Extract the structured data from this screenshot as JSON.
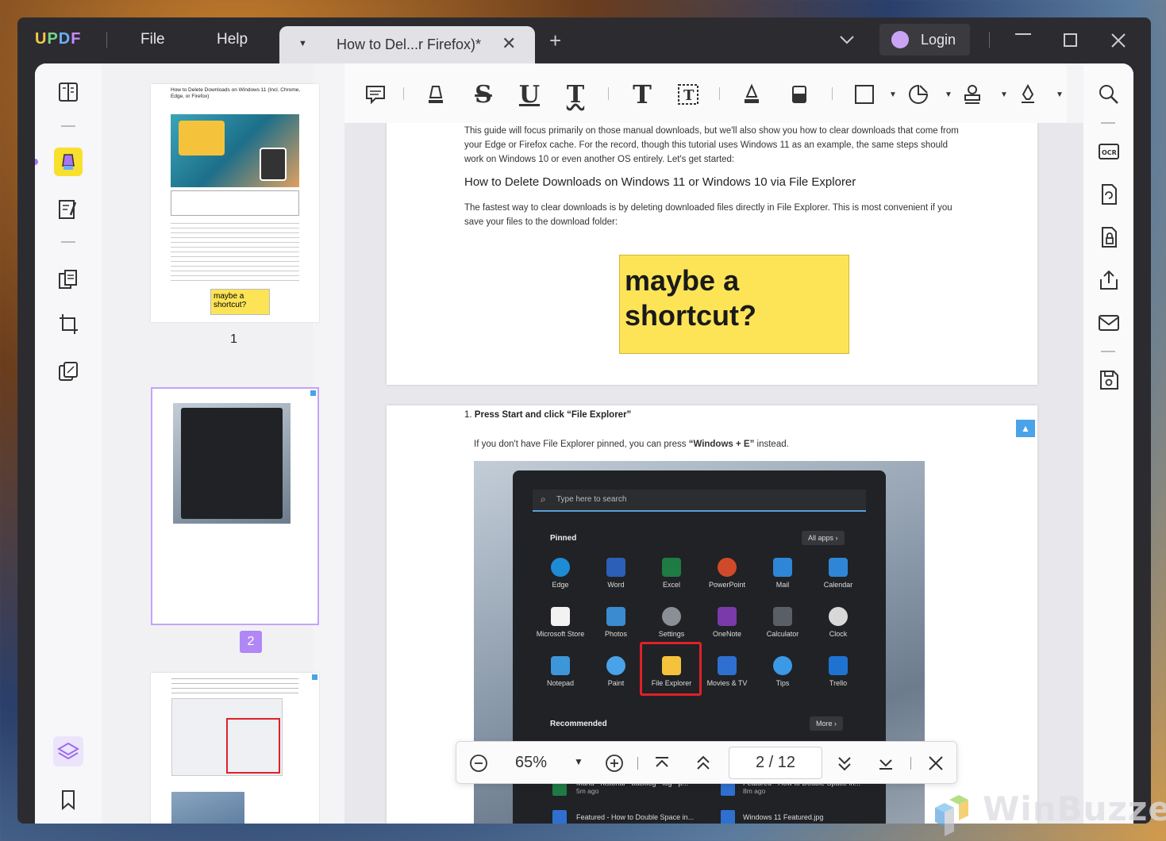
{
  "titlebar": {
    "logo": [
      "U",
      "P",
      "D",
      "F"
    ],
    "menu": {
      "file": "File",
      "help": "Help"
    },
    "tab_title": "How to Del...r Firefox)*",
    "tab_close": "✕",
    "new_tab": "+",
    "login": "Login"
  },
  "thumbnails": {
    "page1_number": "1",
    "page2_number": "2",
    "page1_title": "How to Delete Downloads on Windows 11 (Incl. Chrome, Edge, or Firefox)",
    "page1_sticky": "maybe a shortcut?"
  },
  "document": {
    "intro": "This guide will focus primarily on those manual downloads, but we'll also show you how to clear downloads that come from your Edge or Firefox cache. For the record, though this tutorial uses Windows 11 as an example, the same steps should work on Windows 10 or even another OS entirely. Let's get started:",
    "heading": "How to Delete Downloads on Windows 11 or Windows 10 via File Explorer",
    "paragraph": "The fastest way to clear downloads is by deleting downloaded files directly in File Explorer. This is most convenient if you save your files to the download folder:",
    "sticky_line1": "maybe a",
    "sticky_line2": "shortcut?",
    "step_number": "1.",
    "step_title": "Press Start and click “File Explorer”",
    "step_note_pre": "If you don't have File Explorer pinned, you can press ",
    "step_note_bold": "“Windows + E”",
    "step_note_post": " instead."
  },
  "startmenu": {
    "search_placeholder": "Type here to search",
    "pinned_label": "Pinned",
    "all_apps": "All apps  ›",
    "apps": [
      {
        "name": "Edge",
        "color": "#1e8bd6"
      },
      {
        "name": "Word",
        "color": "#2b5fb8"
      },
      {
        "name": "Excel",
        "color": "#1e7b44"
      },
      {
        "name": "PowerPoint",
        "color": "#d04a2a"
      },
      {
        "name": "Mail",
        "color": "#2f86d6"
      },
      {
        "name": "Calendar",
        "color": "#2f86d6"
      },
      {
        "name": "Microsoft Store",
        "color": "#f2f2f2"
      },
      {
        "name": "Photos",
        "color": "#3a8bd0"
      },
      {
        "name": "Settings",
        "color": "#8a8f96"
      },
      {
        "name": "OneNote",
        "color": "#7a3aa8"
      },
      {
        "name": "Calculator",
        "color": "#5a5f66"
      },
      {
        "name": "Clock",
        "color": "#d8d8d8"
      },
      {
        "name": "Notepad",
        "color": "#3d96d8"
      },
      {
        "name": "Paint",
        "color": "#4aa3e8"
      },
      {
        "name": "File Explorer",
        "color": "#f5c33b"
      },
      {
        "name": "Movies & TV",
        "color": "#2f6fd0"
      },
      {
        "name": "Tips",
        "color": "#3a9ae8"
      },
      {
        "name": "Trello",
        "color": "#1f73d0"
      }
    ],
    "recommended_label": "Recommended",
    "more": "More  ›",
    "recent": [
      {
        "name": "Maria - historial - backlog - log - p...",
        "time": "5m ago"
      },
      {
        "name": "Featured - How to Double Space in...",
        "time": "8m ago"
      },
      {
        "name": "Featured - How to Double Space in...",
        "time": ""
      },
      {
        "name": "Windows 11 Featured.jpg",
        "time": ""
      }
    ]
  },
  "zoombar": {
    "zoom": "65%",
    "current_page": "2",
    "separator": "/",
    "total_pages": "12"
  },
  "watermark": "WinBuzzer"
}
